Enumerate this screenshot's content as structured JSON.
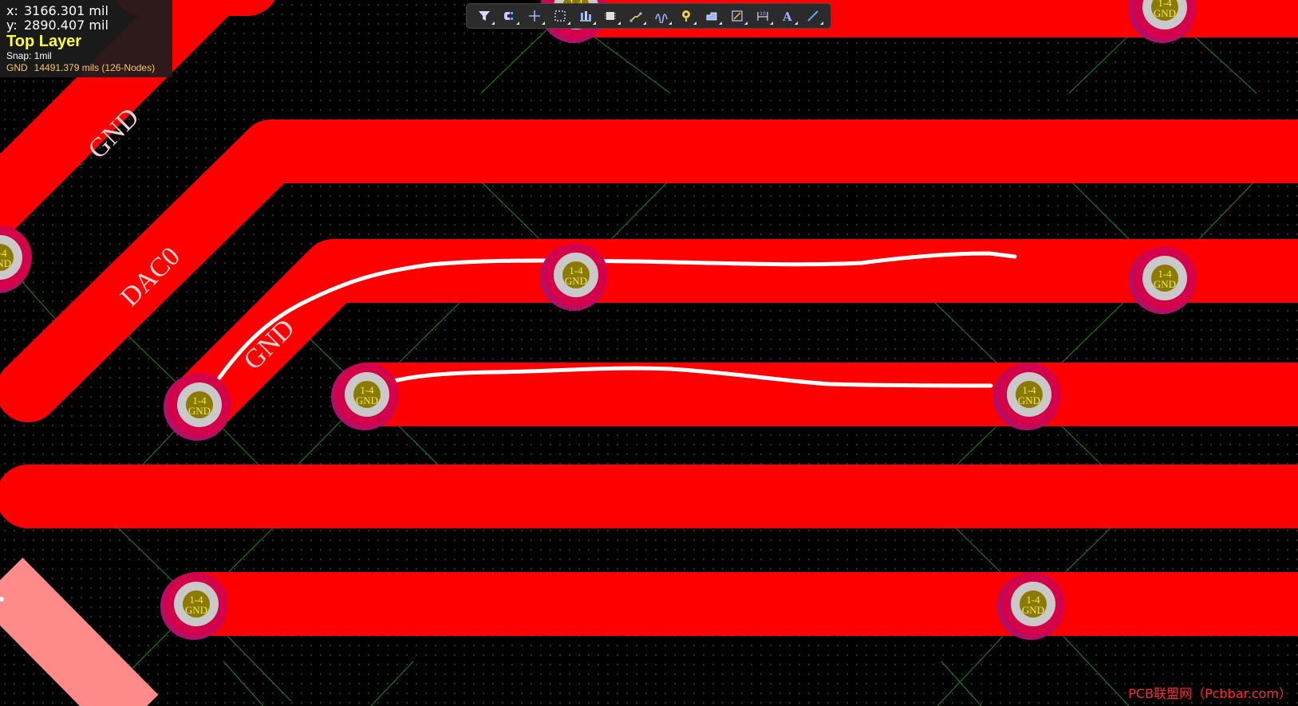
{
  "info_panel": {
    "x_label": "x:",
    "x_value": "3166.301 mil",
    "y_label": "y:",
    "y_value": "2890.407 mil",
    "layer": "Top Layer",
    "snap": "Snap: 1mil",
    "net_name": "GND",
    "net_length": "14491.379 mils (126-Nodes)"
  },
  "toolbar": {
    "buttons": [
      {
        "name": "filter-icon"
      },
      {
        "name": "snap-magnet-icon"
      },
      {
        "name": "crosshair-icon"
      },
      {
        "name": "select-rectangle-icon"
      },
      {
        "name": "align-icon"
      },
      {
        "name": "component-icon"
      },
      {
        "name": "route-icon"
      },
      {
        "name": "interactive-tune-icon"
      },
      {
        "name": "place-via-icon"
      },
      {
        "name": "polygon-pour-icon"
      },
      {
        "name": "place-pad-icon"
      },
      {
        "name": "dimension-icon"
      },
      {
        "name": "text-icon"
      },
      {
        "name": "line-icon"
      }
    ]
  },
  "board": {
    "net_labels": [
      "GND",
      "DAC0",
      "GND"
    ],
    "via_pin_label": "1-4",
    "via_net_label": "GND"
  },
  "watermark": "PCB联盟网（Pcbbar.com）",
  "colors": {
    "trace": "#ff0000",
    "trace_selected": "#ff8a8a",
    "background": "#000000",
    "via_ring": "#c9c9c9",
    "via_core": "#8c7a00",
    "highlight_layer": "#ffff3a",
    "hand_stroke": "#ffffff"
  }
}
